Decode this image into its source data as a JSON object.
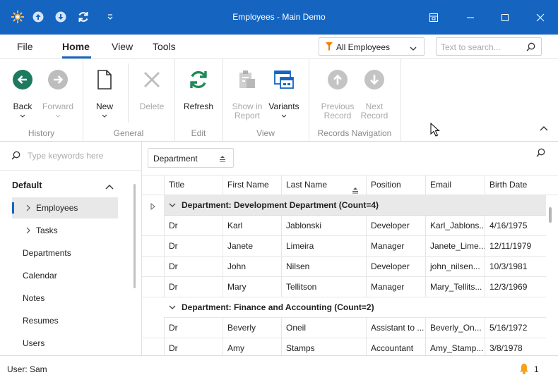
{
  "window": {
    "title": "Employees - Main Demo"
  },
  "menu": {
    "file": "File",
    "home": "Home",
    "view": "View",
    "tools": "Tools",
    "filter_value": "All Employees",
    "search_placeholder": "Text to search..."
  },
  "ribbon": {
    "back": "Back",
    "forward": "Forward",
    "new": "New",
    "delete": "Delete",
    "refresh": "Refresh",
    "show_in_report_1": "Show in",
    "show_in_report_2": "Report",
    "variants": "Variants",
    "previous_record_1": "Previous",
    "previous_record_2": "Record",
    "next_record_1": "Next",
    "next_record_2": "Record",
    "groups": {
      "history": "History",
      "general": "General",
      "edit": "Edit",
      "view": "View",
      "records_navigation": "Records Navigation"
    }
  },
  "nav": {
    "search_placeholder": "Type keywords here",
    "group_title": "Default",
    "items": [
      {
        "label": "Employees"
      },
      {
        "label": "Tasks"
      },
      {
        "label": "Departments"
      },
      {
        "label": "Calendar"
      },
      {
        "label": "Notes"
      },
      {
        "label": "Resumes"
      },
      {
        "label": "Users"
      }
    ]
  },
  "grid": {
    "group_by_chip": "Department",
    "columns": [
      "Title",
      "First Name",
      "Last Name",
      "Position",
      "Email",
      "Birth Date"
    ],
    "groups": [
      {
        "label": "Department: Development Department (Count=4)",
        "rows": [
          [
            "Dr",
            "Karl",
            "Jablonski",
            "Developer",
            "Karl_Jablons...",
            "4/16/1975"
          ],
          [
            "Dr",
            "Janete",
            "Limeira",
            "Manager",
            "Janete_Lime...",
            "12/11/1979"
          ],
          [
            "Dr",
            "John",
            "Nilsen",
            "Developer",
            "john_nilsen...",
            "10/3/1981"
          ],
          [
            "Dr",
            "Mary",
            "Tellitson",
            "Manager",
            "Mary_Tellits...",
            "12/3/1969"
          ]
        ]
      },
      {
        "label": "Department: Finance and Accounting (Count=2)",
        "rows": [
          [
            "Dr",
            "Beverly",
            "Oneil",
            "Assistant to ...",
            "Beverly_On...",
            "5/16/1972"
          ],
          [
            "Dr",
            "Amy",
            "Stamps",
            "Accountant",
            "Amy_Stamp...",
            "3/8/1978"
          ]
        ]
      }
    ]
  },
  "status": {
    "user": "User: Sam",
    "notifications": "1"
  },
  "colors": {
    "accent": "#1565c0",
    "back_button": "#1e7a5e",
    "refresh": "#1e8a5a",
    "notification": "#f5a21b"
  }
}
